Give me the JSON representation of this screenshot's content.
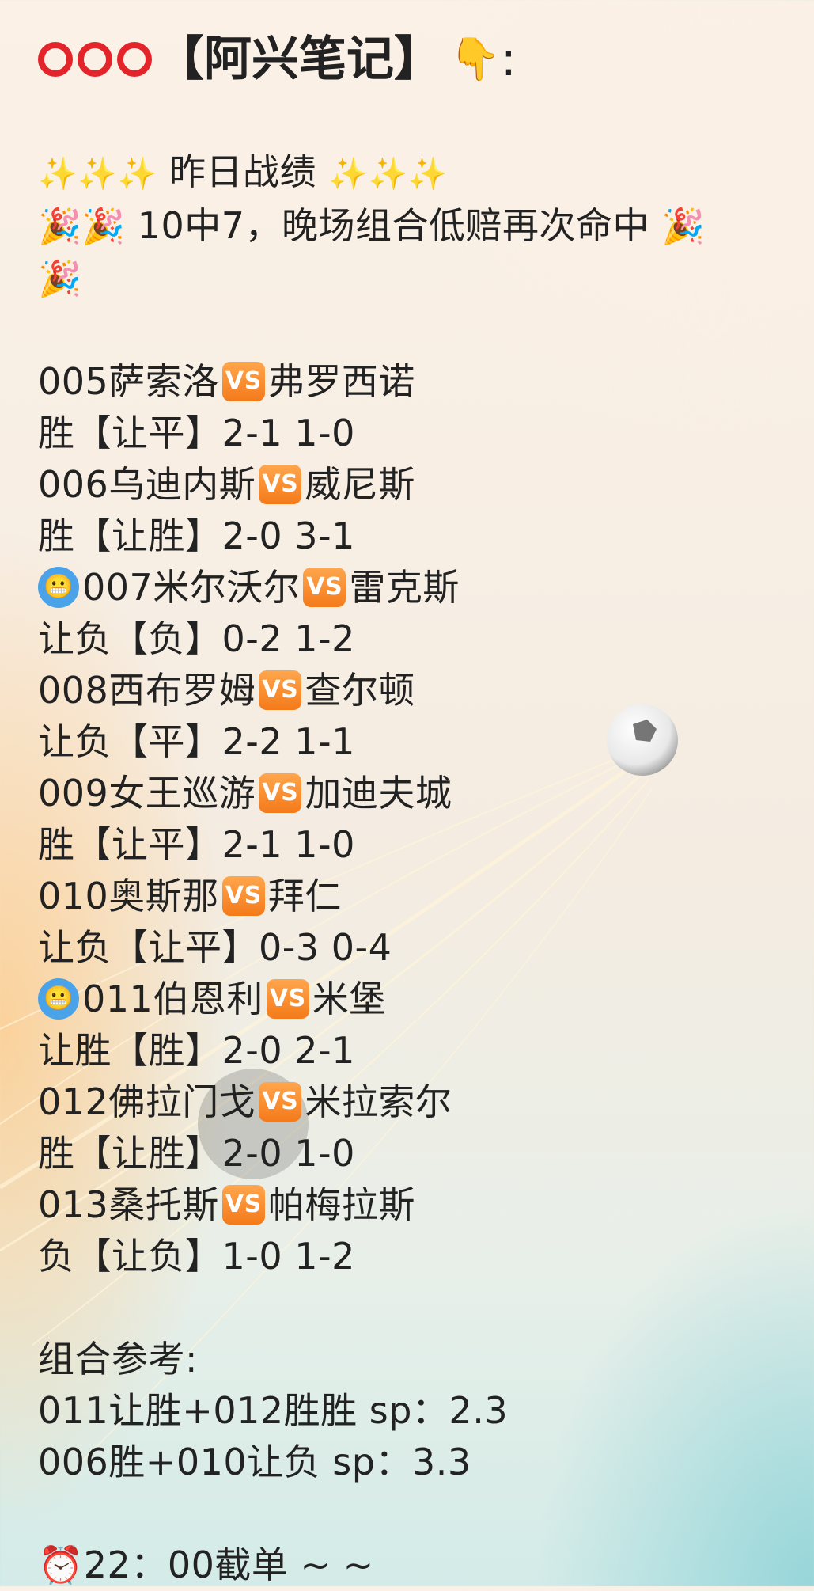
{
  "title": {
    "text": "【阿兴笔记】",
    "colon": ":"
  },
  "header": {
    "left_sparkles": "✨✨✨",
    "label": "昨日战绩",
    "right_sparkles": "✨✨✨"
  },
  "summary": {
    "text": "10中7，晚场组合低赔再次命中"
  },
  "matches": [
    {
      "flag": false,
      "home": "005萨索洛",
      "away": "弗罗西诺",
      "result": "胜【让平】2-1 1-0"
    },
    {
      "flag": false,
      "home": "006乌迪内斯",
      "away": "威尼斯",
      "result": "胜【让胜】2-0 3-1"
    },
    {
      "flag": true,
      "home": "007米尔沃尔",
      "away": "雷克斯",
      "result": "让负【负】0-2 1-2"
    },
    {
      "flag": false,
      "home": "008西布罗姆",
      "away": "查尔顿",
      "result": "让负【平】2-2 1-1"
    },
    {
      "flag": false,
      "home": "009女王巡游",
      "away": "加迪夫城",
      "result": "胜【让平】2-1 1-0"
    },
    {
      "flag": false,
      "home": "010奥斯那",
      "away": "拜仁",
      "result": "让负【让平】0-3 0-4"
    },
    {
      "flag": true,
      "home": "011伯恩利",
      "away": "米堡",
      "result": "让胜【胜】2-0 2-1"
    },
    {
      "flag": false,
      "home": "012佛拉门戈",
      "away": "米拉索尔",
      "result": "胜【让胜】2-0 1-0"
    },
    {
      "flag": false,
      "home": "013桑托斯",
      "away": "帕梅拉斯",
      "result": "负【让负】1-0 1-2"
    }
  ],
  "vs_label": "VS",
  "combo": {
    "heading": "组合参考:",
    "lines": [
      "011让胜+012胜胜  sp：2.3",
      "006胜+010让负  sp：3.3"
    ]
  },
  "deadline": {
    "icon": "⏰",
    "text": "22：00截单 ~ ~"
  },
  "icons": {
    "ring": "red-circle-icon",
    "pointer": "pointing-down-icon",
    "party": "party-popper-icon",
    "flag": "grimace-face-icon",
    "vs": "vs-badge-icon"
  }
}
